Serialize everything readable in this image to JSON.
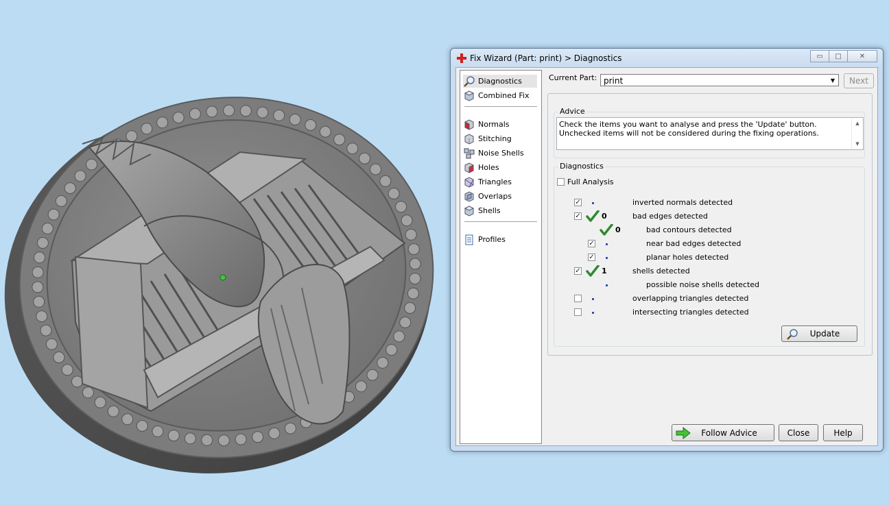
{
  "window": {
    "title": "Fix Wizard (Part: print) > Diagnostics",
    "caption_buttons": {
      "minimize": "▭",
      "maximize": "□",
      "close": "✕"
    }
  },
  "nav": {
    "top_items": [
      {
        "label": "Diagnostics",
        "icon": "magnifier-icon",
        "selected": true
      },
      {
        "label": "Combined Fix",
        "icon": "cube-icon",
        "selected": false
      }
    ],
    "fix_items": [
      {
        "label": "Normals",
        "icon": "normals-cube-icon"
      },
      {
        "label": "Stitching",
        "icon": "stitching-cube-icon"
      },
      {
        "label": "Noise Shells",
        "icon": "noise-shells-icon"
      },
      {
        "label": "Holes",
        "icon": "holes-cube-icon"
      },
      {
        "label": "Triangles",
        "icon": "triangles-cube-icon"
      },
      {
        "label": "Overlaps",
        "icon": "overlaps-cube-icon"
      },
      {
        "label": "Shells",
        "icon": "shells-cube-icon"
      }
    ],
    "profiles_label": "Profiles"
  },
  "part": {
    "label": "Current Part:",
    "value": "print",
    "next_label": "Next"
  },
  "advice": {
    "title": "Advice",
    "text": "Check the items you want to analyse and press the 'Update' button. Unchecked items will not be considered during the fixing operations."
  },
  "diagnostics": {
    "title": "Diagnostics",
    "full_analysis_label": "Full Analysis",
    "full_analysis_checked": false,
    "rows": [
      {
        "label": "inverted normals detected",
        "checked": true,
        "status": "dot",
        "count": ""
      },
      {
        "label": "bad edges detected",
        "checked": true,
        "status": "ok",
        "count": "0"
      },
      {
        "label": "bad contours detected",
        "checked": null,
        "status": "ok",
        "count": "0"
      },
      {
        "label": "near bad edges detected",
        "checked": true,
        "status": "dot",
        "count": ""
      },
      {
        "label": "planar holes detected",
        "checked": true,
        "status": "dot",
        "count": ""
      },
      {
        "label": "shells detected",
        "checked": true,
        "status": "ok",
        "count": "1"
      },
      {
        "label": "possible noise shells detected",
        "checked": null,
        "status": "dot",
        "count": ""
      },
      {
        "label": "overlapping triangles detected",
        "checked": false,
        "status": "dot",
        "count": ""
      },
      {
        "label": "intersecting triangles detected",
        "checked": false,
        "status": "dot",
        "count": ""
      }
    ],
    "update_label": "Update"
  },
  "footer": {
    "follow_advice_label": "Follow Advice",
    "close_label": "Close",
    "help_label": "Help"
  },
  "colors": {
    "background": "#bcdcf4",
    "model_gray": "#8c8c8c",
    "check_green": "#2f8a2f",
    "status_dot": "#1f3fb0"
  }
}
